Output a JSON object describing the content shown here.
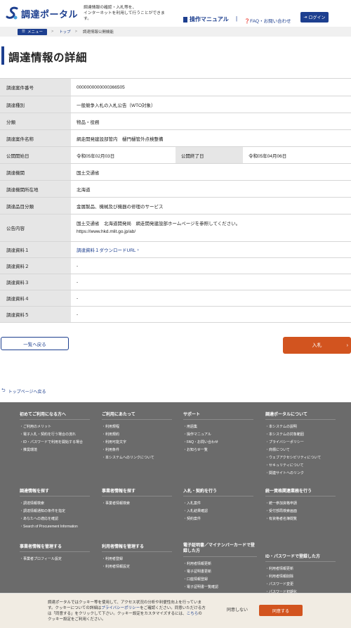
{
  "header": {
    "logo_text": "調達ポータル",
    "tagline_line1": "調達情報の確認・入札等を、",
    "tagline_line2": "インターネットを利用して行うことができます。",
    "manual_label": "操作マニュアル",
    "separator": "|",
    "faq_label": "FAQ・お問い合わせ",
    "login_label": "ログイン"
  },
  "breadcrumb": {
    "menu_label": "メニュー",
    "top_label": "トップ",
    "arrow": ">",
    "current_label": "調達情報公開機能"
  },
  "page": {
    "title": "調達情報の詳細"
  },
  "detail": {
    "case_number_label": "調達案件番号",
    "case_number": "0000000000000366505",
    "category_label": "調達種別",
    "category": "一般競争入札の入札公告（WTO対象）",
    "classification_label": "分類",
    "classification": "物品・役務",
    "case_name_label": "調達案件名称",
    "case_name": "網走開発建設部管内　樋門樋管外点検整備",
    "publish_start_label": "公開開始日",
    "publish_start": "令和05年02月03日",
    "publish_end_label": "公開終了日",
    "publish_end": "令和05年04月06日",
    "agency_label": "調達機関",
    "agency": "国土交通省",
    "location_label": "調達機関所在地",
    "location": "北海道",
    "item_category_label": "調達品目分類",
    "item_category": "金属製品、機械及び機器の修理のサービス",
    "notice_label": "公告内容",
    "notice_line1": "国土交通省　北海道開発局　網走開発建設部ホームページを参照してください。",
    "notice_line2": "https://www.hkd.mlit.go.jp/ab/",
    "doc1_label": "調達資料１",
    "doc1_value": "調達資料１ダウンロードURL",
    "doc2_label": "調達資料２",
    "doc2_value": "-",
    "doc3_label": "調達資料３",
    "doc3_value": "-",
    "doc4_label": "調達資料４",
    "doc4_value": "-",
    "doc5_label": "調達資料５",
    "doc5_value": "-"
  },
  "actions": {
    "back_label": "一覧へ戻る",
    "bid_label": "入札",
    "to_top_label": "トップページへ戻る"
  },
  "footer": {
    "col1_head": "初めてご利用になる方へ",
    "col1_items": [
      "ご利用のメリット",
      "電子入札・契約を行う場合の流れ",
      "ID・パスワードで利用を開始する場合",
      "推奨環境"
    ],
    "col2_head": "ご利用にあたって",
    "col2_items": [
      "利用規程",
      "利用規約",
      "利用可能文字",
      "利用条件",
      "本システムへのリンクについて"
    ],
    "col3_head": "サポート",
    "col3_items": [
      "用語集",
      "操作マニュアル",
      "FAQ・お問い合わせ",
      "お知らせ一覧"
    ],
    "col4_head": "調達ポータルについて",
    "col4_items": [
      "本システムの説明",
      "本システムの対象範囲",
      "プライバシーポリシー",
      "商標について",
      "ウェブアクセシビリティについて",
      "セキュリティについて",
      "関連サイトへのリンク"
    ],
    "col5_head": "調達情報を探す",
    "col5_items": [
      "調達情報検索",
      "調達情報通知の条件を指定",
      "あなたへの適応を確認",
      "Search of Procurement Information"
    ],
    "col6_head": "事業者情報を探す",
    "col6_items": [
      "事業者情報検索"
    ],
    "col7_head": "入札・契約を行う",
    "col7_items": [
      "入札案件",
      "入札結果確認",
      "契約案件"
    ],
    "col8_head": "統一資格関連業務を行う",
    "col8_items": [
      "統一参加資格申請",
      "受付部局検索画面",
      "有資格者名簿閲覧"
    ],
    "col9_head": "事業者情報を管理する",
    "col9_items": [
      "事業者プロフィール設定"
    ],
    "col10_head": "利用者情報を管理する",
    "col10_items": [
      "利用者登録",
      "利用者情報設定"
    ],
    "col11_head": "電子証明書／マイナンバーカードで登録した方",
    "col11_items": [
      "利用者情報更新",
      "電子証明書更新",
      "口座情報登録",
      "電子証明書一覧確認"
    ],
    "col12_head": "ID・パスワードで登録した方",
    "col12_items": [
      "利用者情報更新",
      "利用者情報削除",
      "パスワード変更",
      "パスワード初期化"
    ]
  },
  "cookie": {
    "text_a": "調達ポータルではクッキー等を使用して、アクセス状況の分析や利便性向上を行っています。クッキーについての詳細は",
    "policy_link": "プライバシーポリシー",
    "text_b": "をご確認ください。同意いただける方は「同意する」をクリックして下さい。クッキー設定をカスタマイズするには、",
    "here_link": "こちら",
    "text_c": "のクッキー設定をご利用ください。",
    "deny_label": "同意しない",
    "accept_label": "同意する"
  }
}
